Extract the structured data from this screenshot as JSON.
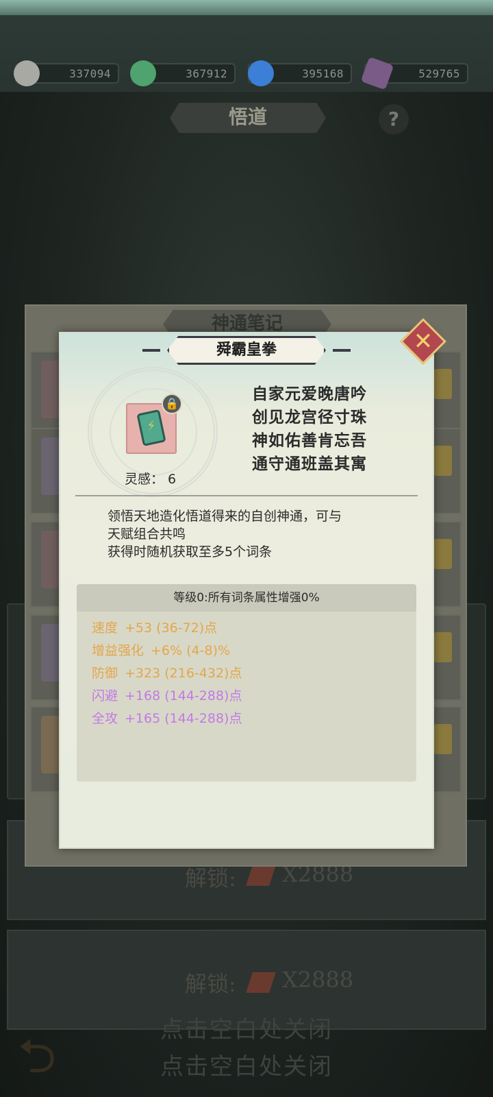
{
  "resources": [
    {
      "icon": "silver-coin-icon",
      "value": "337094",
      "color": "#9a9a96"
    },
    {
      "icon": "jade-ore-icon",
      "value": "367912",
      "color": "#4fa36e"
    },
    {
      "icon": "blue-flame-icon",
      "value": "395168",
      "color": "#3b7fd6"
    },
    {
      "icon": "purple-crystal-icon",
      "value": "529765",
      "color": "#7a5a86"
    }
  ],
  "page": {
    "title": "悟道",
    "help": "?"
  },
  "outer_panel": {
    "title": "神通笔记"
  },
  "unlock_rows": [
    {
      "label": "解锁:",
      "cost": "X2888"
    },
    {
      "label": "解锁:",
      "cost": "X2888"
    }
  ],
  "close_hint": "点击空白处关闭",
  "modal": {
    "title": "舜霸皇拳",
    "inspiration": "灵感：  6",
    "poem": [
      "自家元爱晚唐吟",
      "创见龙宫径寸珠",
      "神如佑善肯忘吾",
      "通守通班盖其寓"
    ],
    "description": [
      "领悟天地造化悟道得来的自创神通，可与",
      "天赋组合共鸣",
      "获得时随机获取至多5个词条"
    ],
    "level_line": "等级0:所有词条属性增强0%",
    "stats": [
      {
        "name": "速度",
        "value": "+53 (36-72)点",
        "color": "#e3a64b"
      },
      {
        "name": "增益强化",
        "value": "+6% (4-8)%",
        "color": "#e3a64b"
      },
      {
        "name": "防御",
        "value": "+323 (216-432)点",
        "color": "#e3a64b"
      },
      {
        "name": "闪避",
        "value": "+168 (144-288)点",
        "color": "#c27ae6"
      },
      {
        "name": "全攻",
        "value": "+165 (144-288)点",
        "color": "#c27ae6"
      }
    ]
  }
}
